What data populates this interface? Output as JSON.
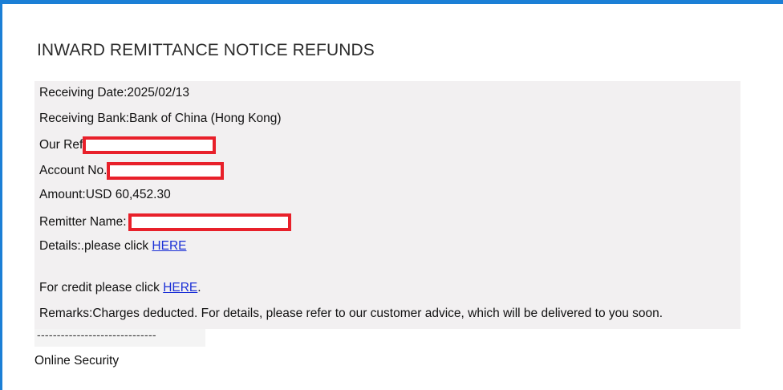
{
  "notice": {
    "title": "INWARD REMITTANCE NOTICE REFUNDS",
    "receiving_date": "Receiving Date:2025/02/13",
    "receiving_bank": "Receiving Bank:Bank of China (Hong Kong)",
    "our_ref_label": "Our Ref",
    "account_no_label": "Account No.",
    "amount": "Amount:USD 60,452.30",
    "remitter_label": "Remitter Name:",
    "details_prefix": "Details:.please click ",
    "details_link": "HERE",
    "credit_prefix": "For credit please click ",
    "credit_link": "HERE",
    "credit_suffix": ".",
    "remarks": "Remarks:Charges deducted. For details, please refer to our customer advice, which will be delivered to you soon.",
    "separator": "------------------------------",
    "signature": "Online Security"
  },
  "colors": {
    "accent_border": "#1b7fd6",
    "redaction": "#e8202a",
    "link": "#1a2fd6",
    "panel_bg": "#f2f0f1"
  }
}
